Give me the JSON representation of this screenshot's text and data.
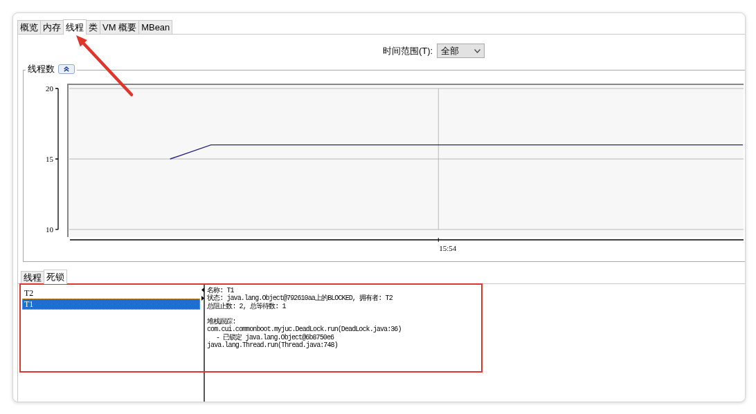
{
  "tabs": [
    {
      "label": "概览",
      "selected": false
    },
    {
      "label": "内存",
      "selected": false
    },
    {
      "label": "线程",
      "selected": true
    },
    {
      "label": "类",
      "selected": false
    },
    {
      "label": "VM 概要",
      "selected": false
    },
    {
      "label": "MBean",
      "selected": false
    }
  ],
  "time_range": {
    "label": "时间范围(T):",
    "value": "全部"
  },
  "thread_chart": {
    "title": "线程数",
    "chart_data": {
      "type": "line",
      "series": [
        {
          "color": "#2b2280",
          "values": [
            null,
            null,
            null,
            null,
            null,
            15,
            15.5,
            16,
            16,
            16,
            16,
            16,
            16,
            16,
            16,
            16,
            16,
            16,
            16,
            16,
            16,
            16,
            16,
            16,
            16,
            16,
            16,
            16,
            16,
            16,
            16,
            16,
            16,
            16
          ]
        }
      ],
      "ylim": [
        10,
        20
      ],
      "yticks": [
        {
          "value": 10,
          "label": "10"
        },
        {
          "value": 15,
          "label": "15"
        },
        {
          "value": 20,
          "label": "20"
        }
      ],
      "annotations": [
        "15:54"
      ]
    }
  },
  "bottom_tabs": [
    {
      "label": "线程",
      "selected": false
    },
    {
      "label": "死锁",
      "selected": true
    }
  ],
  "deadlock": {
    "threads": [
      {
        "name": "T2",
        "selected": false
      },
      {
        "name": "T1",
        "selected": true
      }
    ],
    "details": {
      "lines": [
        "名称: T1",
        "状态: java.lang.Object@792610aa上的BLOCKED, 拥有者: T2",
        "总阻止数: 2, 总等待数: 1"
      ],
      "stack_trace": {
        "title": "堆栈跟踪:",
        "frames": [
          {
            "kind": "frame",
            "text": "com.cui.commonboot.myjuc.DeadLock.run(DeadLock.java:36)"
          },
          {
            "kind": "lock",
            "text": "- 已锁定 java.lang.Object@6b8750e6"
          },
          {
            "kind": "frame",
            "text": "java.lang.Thread.run(Thread.java:748)"
          }
        ]
      }
    }
  }
}
